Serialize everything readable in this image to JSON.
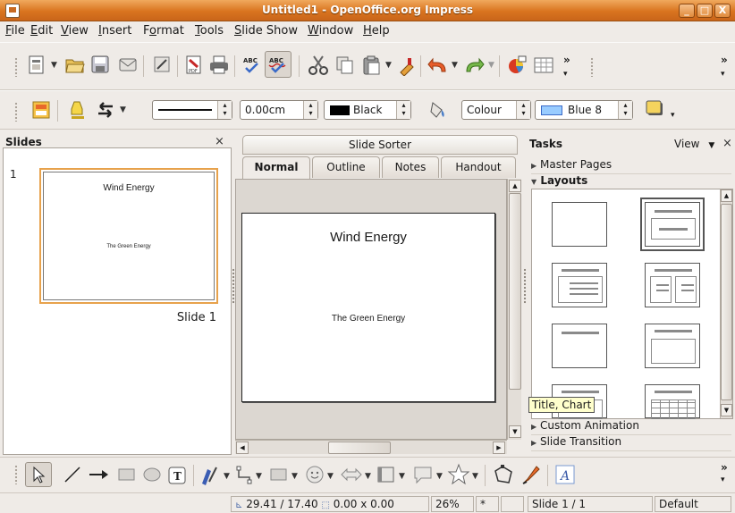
{
  "window": {
    "title": "Untitled1 - OpenOffice.org Impress",
    "minimize": "_",
    "maximize": "□",
    "close": "X"
  },
  "menu": [
    {
      "ul": "F",
      "rest": "ile"
    },
    {
      "ul": "E",
      "rest": "dit"
    },
    {
      "ul": "V",
      "rest": "iew"
    },
    {
      "ul": "I",
      "rest": "nsert"
    },
    {
      "pre": "F",
      "ul": "o",
      "rest": "rmat"
    },
    {
      "ul": "T",
      "rest": "ools"
    },
    {
      "ul": "S",
      "rest": "lide Show"
    },
    {
      "ul": "W",
      "rest": "indow"
    },
    {
      "ul": "H",
      "rest": "elp"
    }
  ],
  "standard_toolbar": {
    "icons": [
      "new-icon",
      "open-icon",
      "save-icon",
      "email-icon",
      "edit-file-icon",
      "export-pdf-icon",
      "print-icon",
      "spellcheck-icon",
      "autospellcheck-icon",
      "cut-icon",
      "copy-icon",
      "paste-icon",
      "clone-format-icon",
      "undo-icon",
      "redo-icon",
      "chart-icon",
      "table-icon"
    ],
    "overflow": "»"
  },
  "line_fill_toolbar": {
    "line_width": "0.00cm",
    "line_color": "Black",
    "line_color_hex": "#000000",
    "area_style": "Colour",
    "area_color": "Blue 8",
    "area_color_hex": "#99ccff"
  },
  "slides_panel": {
    "title": "Slides",
    "close": "×",
    "slides": [
      {
        "number": "1",
        "title": "Wind Energy",
        "subtitle": "The Green Energy",
        "label": "Slide 1"
      }
    ]
  },
  "center": {
    "sorter_tab": "Slide Sorter",
    "tabs": [
      "Normal",
      "Outline",
      "Notes",
      "Handout"
    ],
    "active_tab": "Normal",
    "slide": {
      "title": "Wind Energy",
      "subtitle": "The Green Energy"
    }
  },
  "tasks": {
    "title": "Tasks",
    "view_label": "View",
    "close": "×",
    "sections": {
      "master_pages": "Master Pages",
      "layouts": "Layouts",
      "custom_animation": "Custom Animation",
      "slide_transition": "Slide Transition"
    },
    "tooltip": "Title, Chart"
  },
  "status": {
    "position": "29.41 / 17.40",
    "size": "0.00 x 0.00",
    "zoom": "26%",
    "modified": "*",
    "slide": "Slide 1 / 1",
    "master": "Default"
  }
}
